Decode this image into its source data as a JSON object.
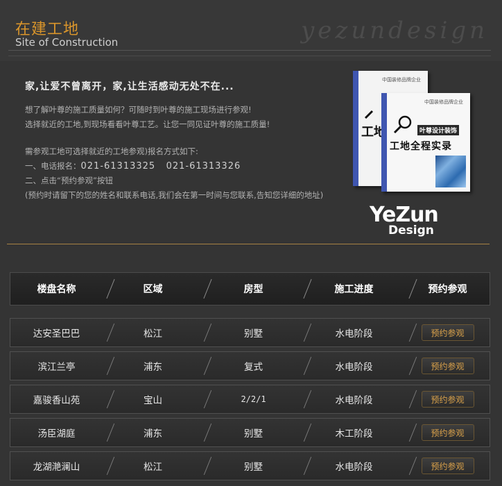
{
  "header": {
    "title_cn": "在建工地",
    "title_en": "Site of Construction",
    "watermark": "yezundesign"
  },
  "intro": {
    "slogan": "家,让爱不曾离开，家,让生活感动无处不在...",
    "line1": "想了解叶尊的施工质量如何？可随时到叶尊的施工现场进行参观!",
    "line2": "选择就近的工地,到现场看看叶尊工艺。让您一同见证叶尊的施工质量!",
    "line3": "需参观工地可选择就近的工地参观)报名方式如下:",
    "line4_label": "一、电话报名：",
    "line4_phones": "021-61313325   021-61313326",
    "line5": "二、点击“预约参观”按钮",
    "line6": "(预约时请留下的您的姓名和联系电话,我们会在第一时间与您联系,告知您详细的地址)"
  },
  "book": {
    "small_text": "中国装修品牌企业",
    "brand": "叶尊设计装饰",
    "title_back": "工地",
    "title_front": "工地全程实录"
  },
  "logo": {
    "main": "YeZun",
    "sub": "Design"
  },
  "table": {
    "headers": [
      "楼盘名称",
      "区域",
      "房型",
      "施工进度",
      "预约参观"
    ],
    "button_label": "预约参观",
    "rows": [
      {
        "name": "达安圣巴巴",
        "area": "松江",
        "type": "别墅",
        "progress": "水电阶段"
      },
      {
        "name": "滨江兰亭",
        "area": "浦东",
        "type": "复式",
        "progress": "水电阶段"
      },
      {
        "name": "嘉骏香山苑",
        "area": "宝山",
        "type": "2/2/1",
        "progress": "水电阶段"
      },
      {
        "name": "汤臣湖庭",
        "area": "浦东",
        "type": "别墅",
        "progress": "木工阶段"
      },
      {
        "name": "龙湖滟澜山",
        "area": "松江",
        "type": "别墅",
        "progress": "水电阶段"
      }
    ]
  },
  "colors": {
    "accent": "#d9952b",
    "gold_line": "#a88244",
    "background": "#343434"
  }
}
